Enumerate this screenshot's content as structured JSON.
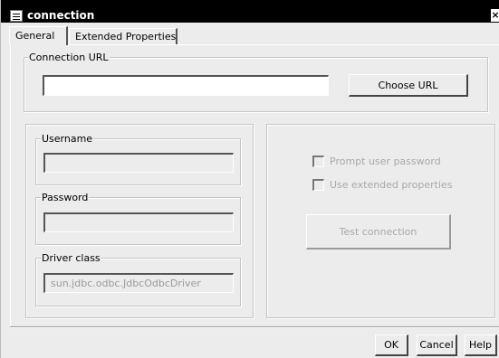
{
  "window": {
    "title": "connection",
    "close_symbol": "×"
  },
  "tabs": [
    {
      "label": "General",
      "active": true
    },
    {
      "label": "Extended Properties",
      "active": false
    }
  ],
  "connection_url": {
    "legend": "Connection URL",
    "value": "",
    "choose_button": "Choose URL"
  },
  "credentials": {
    "username_legend": "Username",
    "username_value": "",
    "password_legend": "Password",
    "password_value": "",
    "driver_legend": "Driver class",
    "driver_value": "sun.jdbc.odbc.JdbcOdbcDriver"
  },
  "options": {
    "prompt_password_label": "Prompt user password",
    "prompt_password_checked": false,
    "use_extended_label": "Use extended properties",
    "use_extended_checked": false,
    "test_button": "Test connection"
  },
  "footer": {
    "ok": "OK",
    "cancel": "Cancel",
    "help": "Help"
  },
  "icons": {
    "window_icon": "window-list-icon",
    "close_icon": "close-icon"
  },
  "colors": {
    "title_bar": "#000000",
    "panel_background": "#ececec",
    "disabled_text": "#a8a8a8"
  }
}
